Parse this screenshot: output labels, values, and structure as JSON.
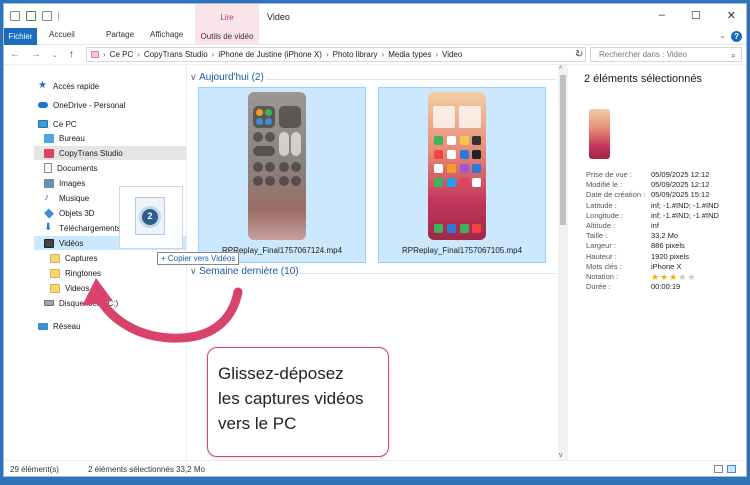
{
  "window": {
    "title": "Video",
    "context_group": "Lire",
    "controls": [
      "–",
      "☐",
      "✕"
    ]
  },
  "ribbon": {
    "tabs": [
      "Fichier",
      "Accueil",
      "Partage",
      "Affichage",
      "Outils de vidéo"
    ]
  },
  "address": {
    "crumbs": [
      "Ce PC",
      "CopyTrans Studio",
      "iPhone de Justine (iPhone X)",
      "Photo library",
      "Media types",
      "Video"
    ],
    "search_placeholder": "Rechercher dans : Video"
  },
  "navpane": {
    "items": [
      {
        "label": "Accès rapide",
        "icon": "star-icon"
      },
      {
        "label": "OneDrive - Personal",
        "icon": "cloud-icon"
      },
      {
        "label": "Ce PC",
        "icon": "computer-icon"
      },
      {
        "label": "Bureau",
        "icon": "desktop-icon"
      },
      {
        "label": "CopyTrans Studio",
        "icon": "copytrans-icon"
      },
      {
        "label": "Documents",
        "icon": "document-icon"
      },
      {
        "label": "Images",
        "icon": "image-icon"
      },
      {
        "label": "Musique",
        "icon": "music-icon"
      },
      {
        "label": "Objets 3D",
        "icon": "cube-icon"
      },
      {
        "label": "Téléchargements",
        "icon": "download-icon"
      },
      {
        "label": "Vidéos",
        "icon": "video-icon"
      },
      {
        "label": "Captures",
        "icon": "folder-icon"
      },
      {
        "label": "Ringtones",
        "icon": "folder-icon"
      },
      {
        "label": "Videos",
        "icon": "folder-icon"
      },
      {
        "label": "Disque local (C:)",
        "icon": "drive-icon"
      },
      {
        "label": "Réseau",
        "icon": "network-icon"
      }
    ]
  },
  "drag": {
    "badge": "2",
    "tooltip": "+ Copier vers Vidéos"
  },
  "content": {
    "group_today": "Aujourd'hui (2)",
    "group_last_week": "Semaine dernière (10)",
    "files": [
      {
        "name": "RPReplay_Final1757067124.mp4"
      },
      {
        "name": "RPReplay_Final1757067105.mp4"
      }
    ]
  },
  "details": {
    "title": "2 éléments sélectionnés",
    "properties": [
      {
        "label": "Prise de vue :",
        "value": "05/09/2025 12:12"
      },
      {
        "label": "Modifié le :",
        "value": "05/09/2025 12:12"
      },
      {
        "label": "Date de création :",
        "value": "05/09/2025 15:12"
      },
      {
        "label": "Latitude :",
        "value": "inf; -1.#IND; -1.#IND"
      },
      {
        "label": "Longitude :",
        "value": "inf; -1.#IND; -1.#IND"
      },
      {
        "label": "Altitude :",
        "value": "inf"
      },
      {
        "label": "Taille :",
        "value": "33,2 Mo"
      },
      {
        "label": "Largeur :",
        "value": "886 pixels"
      },
      {
        "label": "Hauteur :",
        "value": "1920 pixels"
      },
      {
        "label": "Mots clés :",
        "value": "iPhone X"
      },
      {
        "label": "Notation :",
        "value": ""
      },
      {
        "label": "Durée :",
        "value": "00:00:19"
      }
    ],
    "rating": 3,
    "rating_max": 5
  },
  "status": {
    "count": "29 élément(s)",
    "selection": "2 éléments sélectionnés  33,2 Mo"
  },
  "annotation": {
    "line1": "Glissez-déposez",
    "line2": "les captures vidéos",
    "line3": "vers le PC",
    "color": "#d8436b"
  }
}
